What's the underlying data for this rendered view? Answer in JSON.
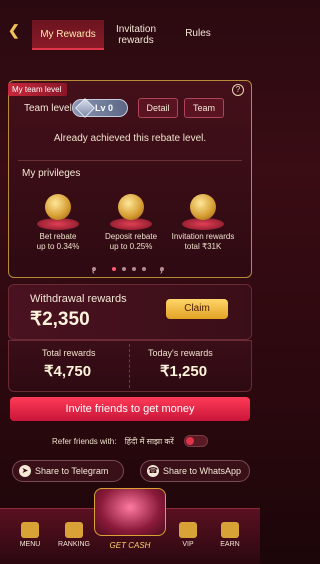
{
  "header": {
    "back_icon": "back-chevron-icon",
    "tabs": [
      {
        "label": "My Rewards",
        "active": true
      },
      {
        "label": "Invitation rewards",
        "active": false
      },
      {
        "label": "Rules",
        "active": false
      }
    ]
  },
  "team": {
    "tag": "My team level",
    "label": "Team level",
    "level": "Lv 0",
    "detail_button": "Detail",
    "team_button": "Team",
    "status": "Already achieved this rebate level."
  },
  "privileges": {
    "title": "My privileges",
    "items": [
      {
        "line1": "Bet rebate",
        "line2": "up to 0.34%"
      },
      {
        "line1": "Deposit rebate",
        "line2": "up to 0.25%"
      },
      {
        "line1": "Invitation rewards",
        "line2": "total ₹31K"
      }
    ],
    "pager": {
      "prev": "‹",
      "next": "›",
      "pages": 4,
      "active": 0
    }
  },
  "withdrawal": {
    "label": "Withdrawal rewards",
    "amount": "₹2,350",
    "claim_button": "Claim"
  },
  "totals": {
    "total_label": "Total rewards",
    "total_value": "₹4,750",
    "today_label": "Today's rewards",
    "today_value": "₹1,250"
  },
  "invite_button": "Invite friends to get money",
  "refer": {
    "label": "Refer friends with:",
    "hindi": "हिंदी में साझा करें",
    "toggle_on": false
  },
  "share": {
    "telegram": "Share to Telegram",
    "whatsapp": "Share to WhatsApp"
  },
  "bottom_nav": {
    "menu": "MENU",
    "ranking": "RANKING",
    "get_cash": "GET CASH",
    "vip": "VIP",
    "earn": "EARN"
  },
  "colors": {
    "accent": "#e0344a",
    "gold": "#d8a236",
    "background": "#2a0a10"
  }
}
